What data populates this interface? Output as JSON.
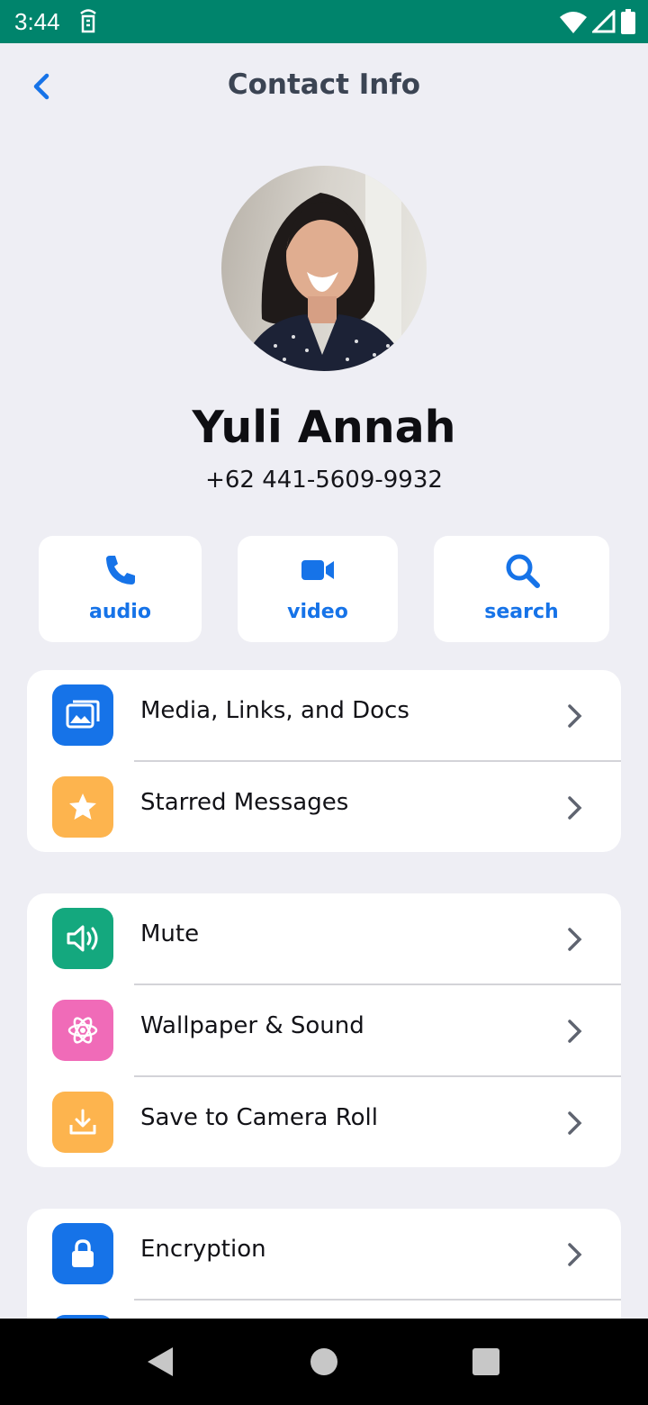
{
  "status_bar": {
    "time": "3:44"
  },
  "header": {
    "title": "Contact Info"
  },
  "contact": {
    "name": "Yuli Annah",
    "phone": "+62 441-5609-9932"
  },
  "actions": [
    {
      "label": "audio",
      "icon": "phone-icon"
    },
    {
      "label": "video",
      "icon": "video-camera-icon"
    },
    {
      "label": "search",
      "icon": "search-icon"
    }
  ],
  "sections": [
    {
      "items": [
        {
          "label": "Media, Links, and Docs",
          "icon": "gallery-icon",
          "color": "#1673E8"
        },
        {
          "label": "Starred Messages",
          "icon": "star-icon",
          "color": "#FDB44E"
        }
      ]
    },
    {
      "items": [
        {
          "label": "Mute",
          "icon": "speaker-icon",
          "color": "#14A87E"
        },
        {
          "label": "Wallpaper & Sound",
          "icon": "atom-icon",
          "color": "#F06BB8"
        },
        {
          "label": "Save to Camera Roll",
          "icon": "download-icon",
          "color": "#FDB44E"
        }
      ]
    },
    {
      "items": [
        {
          "label": "Encryption",
          "icon": "lock-icon",
          "color": "#1673E8"
        }
      ]
    }
  ],
  "colors": {
    "accent": "#1673E8",
    "status_bar": "#00846C",
    "background": "#EEEEF4"
  }
}
